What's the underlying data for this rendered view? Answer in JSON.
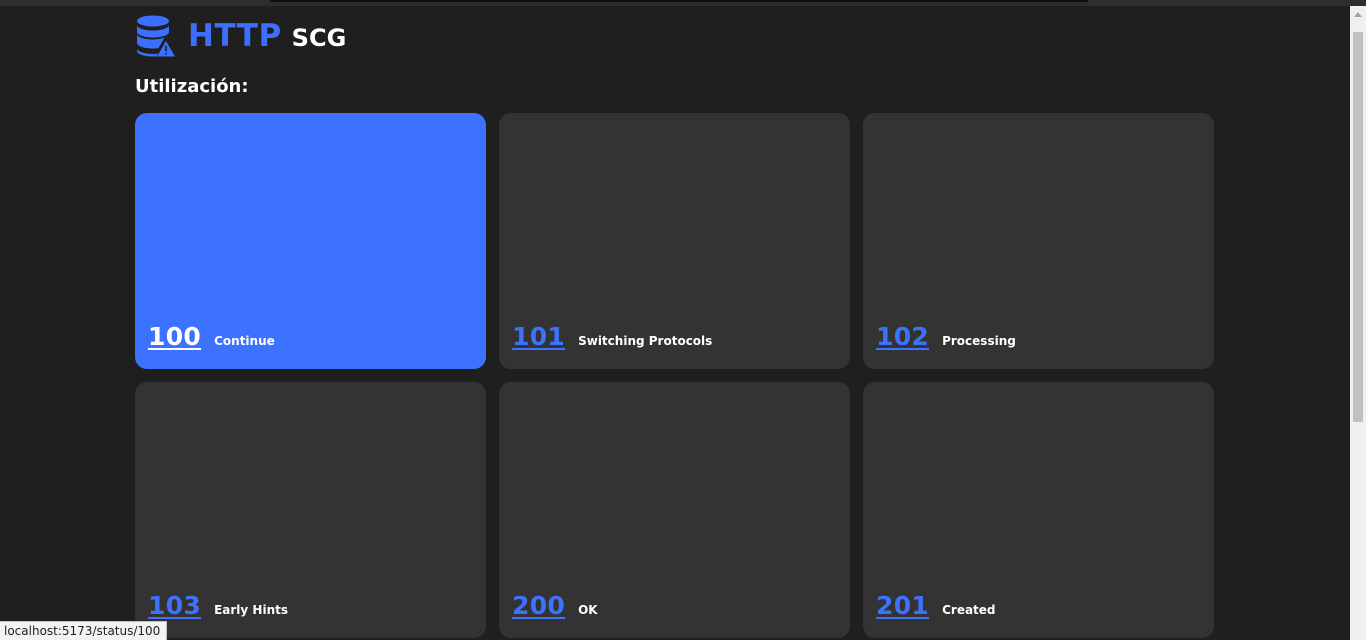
{
  "brand": {
    "main": "HTTP",
    "sub": "SCG",
    "icon": "database-warning-icon",
    "color": "#3d6ffe"
  },
  "section": {
    "title": "Utilización:"
  },
  "cards": [
    {
      "code": "100",
      "label": "Continue",
      "active": true
    },
    {
      "code": "101",
      "label": "Switching Protocols",
      "active": false
    },
    {
      "code": "102",
      "label": "Processing",
      "active": false
    },
    {
      "code": "103",
      "label": "Early Hints",
      "active": false
    },
    {
      "code": "200",
      "label": "OK",
      "active": false
    },
    {
      "code": "201",
      "label": "Created",
      "active": false
    }
  ],
  "status_bar": {
    "url": "localhost:5173/status/100"
  },
  "colors": {
    "accent": "#3d72fe",
    "background": "#1f1f1f",
    "card": "#333333"
  }
}
